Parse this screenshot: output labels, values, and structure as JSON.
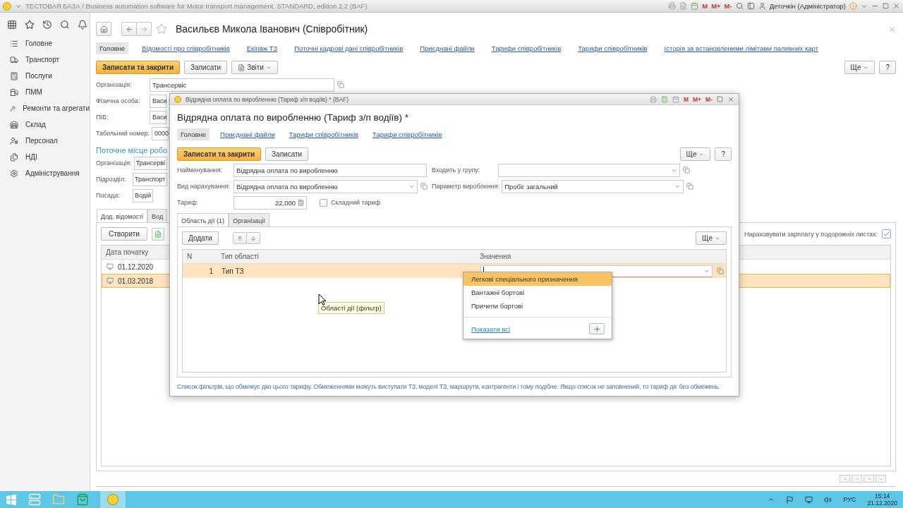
{
  "app_window": {
    "title": "ТЕСТОВАЯ БАЗА / Business automation software for Motor transport management. STANDARD, edition 2.2 (BAF)",
    "memory_buttons": [
      "M",
      "M+",
      "M-"
    ],
    "user": "Деточкін (Адміністратор)"
  },
  "sidebar": {
    "items": [
      {
        "label": "Головне"
      },
      {
        "label": "Транспорт"
      },
      {
        "label": "Послуги"
      },
      {
        "label": "ПММ"
      },
      {
        "label": "Ремонти та агрегати"
      },
      {
        "label": "Склад"
      },
      {
        "label": "Персонал"
      },
      {
        "label": "НДІ"
      },
      {
        "label": "Адміністрування"
      }
    ]
  },
  "form": {
    "title": "Васильєв Микола Іванович (Співробітник)",
    "nav": [
      {
        "label": "Головне",
        "selected": true
      },
      {
        "label": "Відомості про співробітників",
        "selected": false
      },
      {
        "label": "Екіпаж ТЗ",
        "selected": false
      },
      {
        "label": "Поточні кадрові дані співробітників",
        "selected": false
      },
      {
        "label": "Приєднані файли",
        "selected": false
      },
      {
        "label": "Тарифи співробітників",
        "selected": false
      },
      {
        "label": "Тарифи співробітників",
        "selected": false
      },
      {
        "label": "Історія за встановленими лімітами паливних карт",
        "selected": false
      }
    ],
    "toolbar": {
      "save_close": "Записати та закрити",
      "save": "Записати",
      "reports": "Звіти",
      "more": "Ще",
      "help": "?"
    },
    "fields": [
      {
        "label": "Організація:",
        "value": "Трансервіс"
      },
      {
        "label": "Фізична особа:",
        "value": "Васи"
      },
      {
        "label": "ПІБ:",
        "value": "Васи"
      },
      {
        "label": "Табельний номер:",
        "value": "0000"
      }
    ],
    "section_title": "Поточне місце робо",
    "work_fields": [
      {
        "label": "Організація:",
        "value": "Трансерві"
      },
      {
        "label": "Підрозділ:",
        "value": "Транспорт"
      },
      {
        "label": "Посада:",
        "value": "Водій"
      }
    ],
    "tabs": [
      {
        "label": "Дод. відомості",
        "selected": true
      },
      {
        "label": "Вод",
        "selected": false
      }
    ],
    "create_button": "Створити",
    "salary_option": {
      "label": "Нараховувати зарплату у подорожніх листах:",
      "checked": true
    },
    "table": {
      "columns": [
        "Дата початку"
      ],
      "rows": [
        {
          "date": "01.12.2020",
          "selected": false
        },
        {
          "date": "01.03.2018",
          "selected": true
        }
      ]
    }
  },
  "dialog": {
    "window_title": "Відрядна оплата по виробленню (Тариф з/п водіїв) * (BAF)",
    "memory_buttons": [
      "M",
      "M+",
      "M-"
    ],
    "title": "Відрядна оплата по виробленню (Тариф з/п водіїв) *",
    "nav": [
      {
        "label": "Головне",
        "selected": true
      },
      {
        "label": "Приєднані файли",
        "selected": false
      },
      {
        "label": "Тарифи співробітників",
        "selected": false
      },
      {
        "label": "Тарифи співробітників",
        "selected": false
      }
    ],
    "toolbar": {
      "save_close": "Записати та закрити",
      "save": "Записати",
      "more": "Ще",
      "help": "?"
    },
    "name": {
      "label": "Найменування:",
      "value": "Відрядна оплата по виробленню"
    },
    "group": {
      "label": "Входить у групу:"
    },
    "accrual": {
      "label": "Вид нарахування:",
      "value": "Відрядна оплата по виробленню"
    },
    "parameter": {
      "label": "Параметр вироблення:",
      "value": "Пробіг загальний"
    },
    "tariff": {
      "label": "Тариф:",
      "value": "22,000"
    },
    "complex_tariff": {
      "label": "Складний тариф",
      "checked": false
    },
    "tabs": [
      {
        "label": "Область дії (1)",
        "selected": true
      },
      {
        "label": "Організації",
        "selected": false
      }
    ],
    "add_button": "Додати",
    "more": "Ще",
    "table": {
      "columns": [
        "N",
        "Тип області",
        "Значення"
      ],
      "rows": [
        {
          "n": "1",
          "type": "Тип ТЗ",
          "selected": true
        }
      ]
    },
    "dropdown": {
      "options": [
        {
          "label": "Легкові спеціального призначення",
          "selected": true
        },
        {
          "label": "Вантажні бортові",
          "selected": false
        },
        {
          "label": "Причепи бортові",
          "selected": false
        }
      ],
      "show_all": "Показати всі"
    },
    "tooltip": "Області дії (фільтр)",
    "hint": "Список фільтрів, що обмежує дію цього тарифу. Обмеженнями можуть виступати ТЗ, моделі ТЗ, маршрути, контрагенти і тому подібне. Якщо список не заповнений, то тариф діє без обмежень."
  },
  "taskbar": {
    "language": "РУС",
    "time": "15:14",
    "date": "21.12.2020"
  }
}
